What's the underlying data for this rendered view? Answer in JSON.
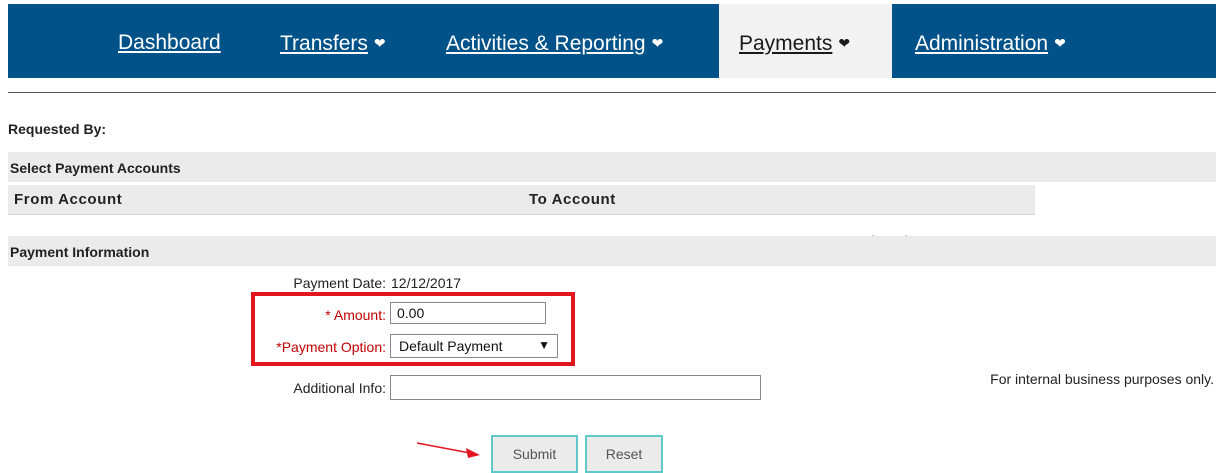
{
  "nav": {
    "items": [
      {
        "label": "Dashboard",
        "has_dropdown": false,
        "active": false
      },
      {
        "label": "Transfers",
        "has_dropdown": true,
        "active": false
      },
      {
        "label": "Activities & Reporting",
        "has_dropdown": true,
        "active": false
      },
      {
        "label": "Payments",
        "has_dropdown": true,
        "active": true
      },
      {
        "label": "Administration",
        "has_dropdown": true,
        "active": false
      }
    ],
    "chevron_icon": "chevron-down-icon",
    "background": "#005288",
    "active_background": "#f2f2f2"
  },
  "requested_by": {
    "label": "Requested By:"
  },
  "payment_accounts": {
    "title": "Select Payment Accounts",
    "from_label": "From Account",
    "to_label": "To Account"
  },
  "payment_info": {
    "title": "Payment Information",
    "date_label": "Payment Date:",
    "date_value": "12/12/2017",
    "amount_label": "* Amount:",
    "amount_value": "0.00",
    "option_label": "*Payment Option:",
    "option_selected": "Default Payment",
    "additional_label": "Additional Info:",
    "additional_value": "",
    "note": "For internal business purposes only."
  },
  "buttons": {
    "submit": "Submit",
    "reset": "Reset"
  },
  "colors": {
    "required": "#c00000",
    "highlight": "#e3161e",
    "button_border": "#5fc9c9"
  }
}
